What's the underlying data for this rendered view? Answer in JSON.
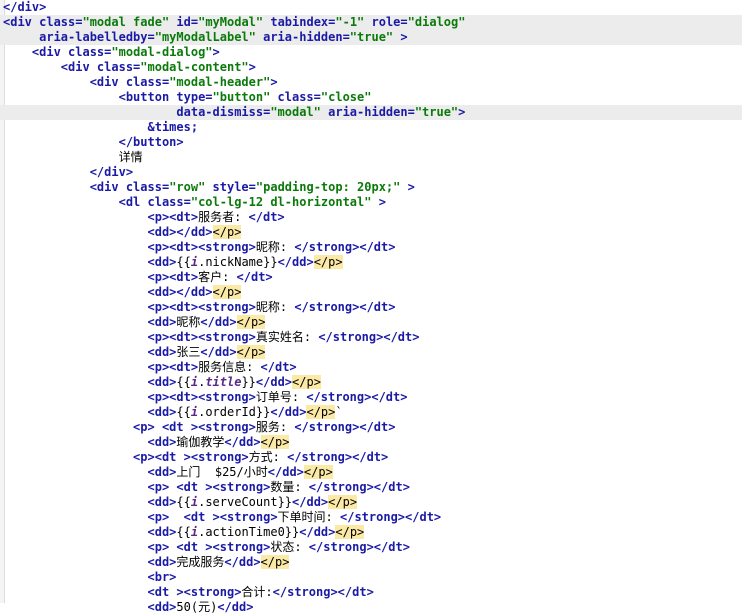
{
  "editor": {
    "language": "html",
    "lines": [
      [
        [
          "tg",
          "</div>"
        ]
      ],
      [
        [
          "tg",
          "<div "
        ],
        [
          "at",
          "class="
        ],
        [
          "st",
          "\"modal fade\""
        ],
        [
          "at",
          " id="
        ],
        [
          "st",
          "\"myModal\""
        ],
        [
          "at",
          " tabindex="
        ],
        [
          "st",
          "\"-1\""
        ],
        [
          "at",
          " role="
        ],
        [
          "st",
          "\"dialog\""
        ]
      ],
      [
        [
          "tx",
          "     "
        ],
        [
          "at",
          "aria-labelledby="
        ],
        [
          "st",
          "\"myModalLabel\""
        ],
        [
          "at",
          " aria-hidden="
        ],
        [
          "st",
          "\"true\""
        ],
        [
          "tg",
          " >"
        ]
      ],
      [
        [
          "tx",
          "    "
        ],
        [
          "tg",
          "<div "
        ],
        [
          "at",
          "class="
        ],
        [
          "st",
          "\"modal-dialog\""
        ],
        [
          "tg",
          ">"
        ]
      ],
      [
        [
          "tx",
          "        "
        ],
        [
          "tg",
          "<div "
        ],
        [
          "at",
          "class="
        ],
        [
          "st",
          "\"modal-content\""
        ],
        [
          "tg",
          ">"
        ]
      ],
      [
        [
          "tx",
          "            "
        ],
        [
          "tg",
          "<div "
        ],
        [
          "at",
          "class="
        ],
        [
          "st",
          "\"modal-header\""
        ],
        [
          "tg",
          ">"
        ]
      ],
      [
        [
          "tx",
          "                "
        ],
        [
          "tg",
          "<button "
        ],
        [
          "at",
          "type="
        ],
        [
          "st",
          "\"button\""
        ],
        [
          "at",
          " class="
        ],
        [
          "st",
          "\"close\""
        ]
      ],
      [
        [
          "tx",
          "                        "
        ],
        [
          "at",
          "data-dismiss="
        ],
        [
          "st",
          "\"modal\""
        ],
        [
          "at",
          " aria-hidden="
        ],
        [
          "st",
          "\"true\""
        ],
        [
          "tg",
          ">"
        ]
      ],
      [
        [
          "tx",
          "                    "
        ],
        [
          "tg",
          "&times;"
        ]
      ],
      [
        [
          "tx",
          "                "
        ],
        [
          "tg",
          "</button>"
        ]
      ],
      [
        [
          "tx",
          "                详情"
        ]
      ],
      [
        [
          "tx",
          "            "
        ],
        [
          "tg",
          "</div>"
        ]
      ],
      [
        [
          "tx",
          "            "
        ],
        [
          "tg",
          "<div "
        ],
        [
          "at",
          "class="
        ],
        [
          "st",
          "\"row\""
        ],
        [
          "at",
          " style="
        ],
        [
          "st",
          "\"padding-top: 20px;\""
        ],
        [
          "tg",
          " >"
        ]
      ],
      [
        [
          "tx",
          "                "
        ],
        [
          "tg",
          "<dl "
        ],
        [
          "at",
          "class="
        ],
        [
          "st",
          "\"col-lg-12 dl-horizontal\""
        ],
        [
          "tg",
          " >"
        ]
      ],
      [
        [
          "tx",
          "                    "
        ],
        [
          "tg",
          "<p><dt>"
        ],
        [
          "tx",
          "服务者: "
        ],
        [
          "tg",
          "</dt>"
        ]
      ],
      [
        [
          "tx",
          "                    "
        ],
        [
          "tg",
          "<dd></dd>"
        ],
        [
          "mk",
          "</p>"
        ]
      ],
      [
        [
          "tx",
          "                    "
        ],
        [
          "tg",
          "<p><dt><strong>"
        ],
        [
          "tx",
          "昵称: "
        ],
        [
          "tg",
          "</strong></dt>"
        ]
      ],
      [
        [
          "tx",
          "                    "
        ],
        [
          "tg",
          "<dd>"
        ],
        [
          "tx",
          "{{"
        ],
        [
          "va",
          "i"
        ],
        [
          "tx",
          ".nickName}}"
        ],
        [
          "tg",
          "</dd>"
        ],
        [
          "mk",
          "</p>"
        ]
      ],
      [
        [
          "tx",
          "                    "
        ],
        [
          "tg",
          "<p><dt>"
        ],
        [
          "tx",
          "客户: "
        ],
        [
          "tg",
          "</dt>"
        ]
      ],
      [
        [
          "tx",
          "                    "
        ],
        [
          "tg",
          "<dd></dd>"
        ],
        [
          "mk",
          "</p>"
        ]
      ],
      [
        [
          "tx",
          "                    "
        ],
        [
          "tg",
          "<p><dt><strong>"
        ],
        [
          "tx",
          "昵称: "
        ],
        [
          "tg",
          "</strong></dt>"
        ]
      ],
      [
        [
          "tx",
          "                    "
        ],
        [
          "tg",
          "<dd>"
        ],
        [
          "tx",
          "昵称"
        ],
        [
          "tg",
          "</dd>"
        ],
        [
          "mk",
          "</p>"
        ]
      ],
      [
        [
          "tx",
          "                    "
        ],
        [
          "tg",
          "<p><dt><strong>"
        ],
        [
          "tx",
          "真实姓名: "
        ],
        [
          "tg",
          "</strong></dt>"
        ]
      ],
      [
        [
          "tx",
          "                    "
        ],
        [
          "tg",
          "<dd>"
        ],
        [
          "tx",
          "张三"
        ],
        [
          "tg",
          "</dd>"
        ],
        [
          "mk",
          "</p>"
        ]
      ],
      [
        [
          "tx",
          "                    "
        ],
        [
          "tg",
          "<p><dt>"
        ],
        [
          "tx",
          "服务信息: "
        ],
        [
          "tg",
          "</dt>"
        ]
      ],
      [
        [
          "tx",
          "                    "
        ],
        [
          "tg",
          "<dd>"
        ],
        [
          "tx",
          "{{"
        ],
        [
          "va",
          "i"
        ],
        [
          "tx",
          "."
        ],
        [
          "va",
          "title"
        ],
        [
          "tx",
          "}}"
        ],
        [
          "tg",
          "</dd>"
        ],
        [
          "mk",
          "</p>"
        ]
      ],
      [
        [
          "tx",
          "                    "
        ],
        [
          "tg",
          "<p><dt><strong>"
        ],
        [
          "tx",
          "订单号: "
        ],
        [
          "tg",
          "</strong></dt>"
        ]
      ],
      [
        [
          "tx",
          "                    "
        ],
        [
          "tg",
          "<dd>"
        ],
        [
          "tx",
          "{{"
        ],
        [
          "va",
          "i"
        ],
        [
          "tx",
          ".orderId}}"
        ],
        [
          "tg",
          "</dd>"
        ],
        [
          "mk",
          "</p>"
        ],
        [
          "tx",
          "`"
        ]
      ],
      [
        [
          "tx",
          "                  "
        ],
        [
          "tg",
          "<p> <dt ><strong>"
        ],
        [
          "tx",
          "服务: "
        ],
        [
          "tg",
          "</strong></dt>"
        ]
      ],
      [
        [
          "tx",
          "                    "
        ],
        [
          "tg",
          "<dd>"
        ],
        [
          "tx",
          "瑜伽教学"
        ],
        [
          "tg",
          "</dd>"
        ],
        [
          "mk",
          "</p>"
        ]
      ],
      [
        [
          "tx",
          "                  "
        ],
        [
          "tg",
          "<p><dt ><strong>"
        ],
        [
          "tx",
          "方式: "
        ],
        [
          "tg",
          "</strong></dt>"
        ]
      ],
      [
        [
          "tx",
          "                    "
        ],
        [
          "tg",
          "<dd>"
        ],
        [
          "tx",
          "上门  $25/小时"
        ],
        [
          "tg",
          "</dd>"
        ],
        [
          "mk",
          "</p>"
        ]
      ],
      [
        [
          "tx",
          "                    "
        ],
        [
          "tg",
          "<p> <dt ><strong>"
        ],
        [
          "tx",
          "数量: "
        ],
        [
          "tg",
          "</strong></dt>"
        ]
      ],
      [
        [
          "tx",
          "                    "
        ],
        [
          "tg",
          "<dd>"
        ],
        [
          "tx",
          "{{"
        ],
        [
          "va",
          "i"
        ],
        [
          "tx",
          ".serveCount}}"
        ],
        [
          "tg",
          "</dd>"
        ],
        [
          "mk",
          "</p>"
        ]
      ],
      [
        [
          "tx",
          "                    "
        ],
        [
          "tg",
          "<p>  <dt ><strong>"
        ],
        [
          "tx",
          "下单时间: "
        ],
        [
          "tg",
          "</strong></dt>"
        ]
      ],
      [
        [
          "tx",
          "                    "
        ],
        [
          "tg",
          "<dd>"
        ],
        [
          "tx",
          "{{"
        ],
        [
          "va",
          "i"
        ],
        [
          "tx",
          ".actionTime0}}"
        ],
        [
          "tg",
          "</dd>"
        ],
        [
          "mk",
          "</p>"
        ]
      ],
      [
        [
          "tx",
          "                    "
        ],
        [
          "tg",
          "<p> <dt ><strong>"
        ],
        [
          "tx",
          "状态: "
        ],
        [
          "tg",
          "</strong></dt>"
        ]
      ],
      [
        [
          "tx",
          "                    "
        ],
        [
          "tg",
          "<dd>"
        ],
        [
          "tx",
          "完成服务"
        ],
        [
          "tg",
          "</dd>"
        ],
        [
          "mk",
          "</p>"
        ]
      ],
      [
        [
          "tx",
          "                    "
        ],
        [
          "tg",
          "<br>"
        ]
      ],
      [
        [
          "tx",
          "                    "
        ],
        [
          "tg",
          "<dt ><strong>"
        ],
        [
          "tx",
          "合计:"
        ],
        [
          "tg",
          "</strong></dt>"
        ]
      ],
      [
        [
          "tx",
          "                    "
        ],
        [
          "tg",
          "<dd>"
        ],
        [
          "tx",
          "50(元)"
        ],
        [
          "tg",
          "</dd>"
        ]
      ]
    ]
  }
}
